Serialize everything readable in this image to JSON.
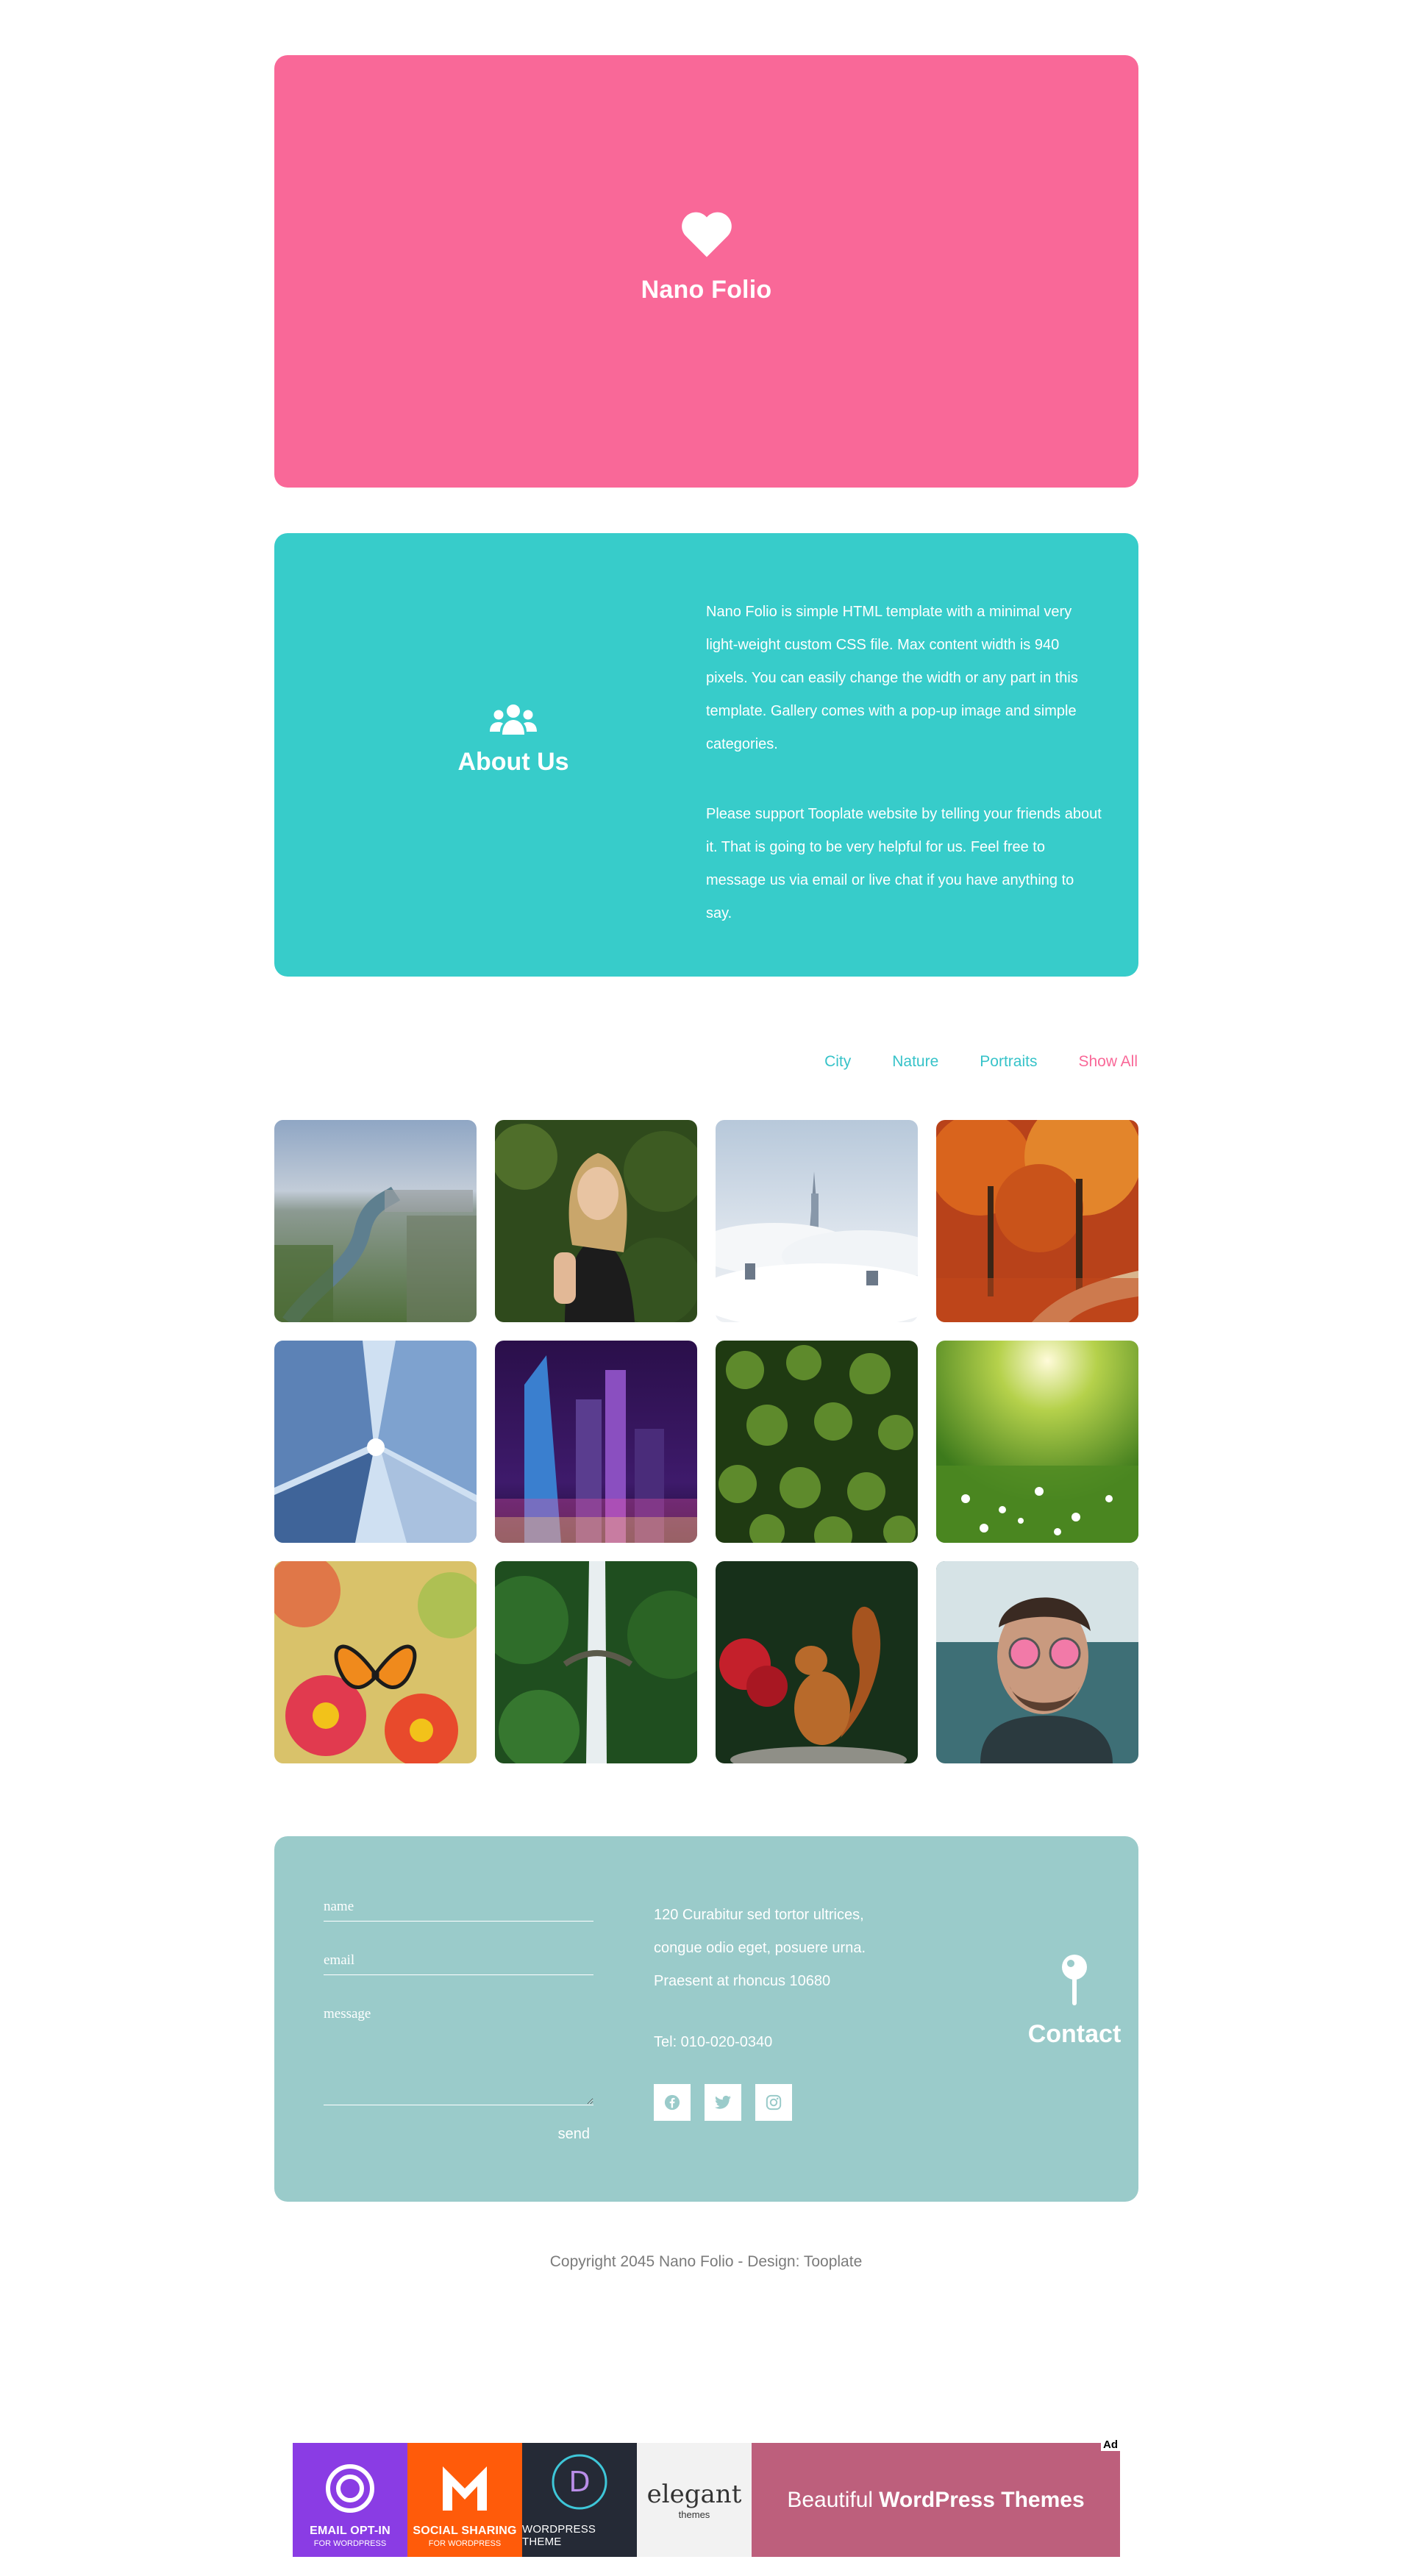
{
  "hero": {
    "title": "Nano Folio",
    "icon": "heart-icon",
    "color": "#f96898"
  },
  "about": {
    "title": "About Us",
    "icon": "users-icon",
    "color": "#37ccca",
    "paragraphs": [
      "Nano Folio is simple HTML template with a minimal very light-weight custom CSS file. Max content width is 940 pixels. You can easily change the width or any part in this template. Gallery comes with a pop-up image and simple categories.",
      "Please support Tooplate website by telling your friends about it. That is going to be very helpful for us. Feel free to message us via email or live chat if you have anything to say."
    ]
  },
  "filters": [
    "City",
    "Nature",
    "Portraits",
    "Show All"
  ],
  "filters_active": "Show All",
  "gallery": [
    {
      "name": "city-river-aerial"
    },
    {
      "name": "woman-forest-portrait"
    },
    {
      "name": "city-above-clouds"
    },
    {
      "name": "autumn-forest-path"
    },
    {
      "name": "skyscrapers-looking-up"
    },
    {
      "name": "city-night-skyline"
    },
    {
      "name": "forest-aerial-trees"
    },
    {
      "name": "sunny-meadow-flowers"
    },
    {
      "name": "butterfly-on-flowers"
    },
    {
      "name": "waterfall-bridge"
    },
    {
      "name": "red-squirrel"
    },
    {
      "name": "man-pink-sunglasses"
    }
  ],
  "contact": {
    "title": "Contact",
    "icon": "map-pin-icon",
    "color": "#9acbca",
    "form": {
      "name_placeholder": "name",
      "email_placeholder": "email",
      "message_placeholder": "message",
      "send_label": "send"
    },
    "address": [
      "120 Curabitur sed tortor ultrices,",
      "congue odio eget, posuere urna.",
      "Praesent at rhoncus 10680"
    ],
    "tel": "Tel: 010-020-0340",
    "socials": [
      "facebook-icon",
      "twitter-icon",
      "instagram-icon"
    ]
  },
  "copyright": "Copyright 2045 Nano Folio - Design: Tooplate",
  "ad": {
    "badge": "Ad",
    "blocks": [
      {
        "line1": "EMAIL OPT-IN",
        "line2": "FOR WORDPRESS"
      },
      {
        "line1": "SOCIAL SHARING",
        "line2": "FOR WORDPRESS"
      },
      {
        "line1": "WORDPRESS THEME",
        "line2": ""
      },
      {
        "line1": "elegant",
        "line2": "themes"
      }
    ],
    "headline_light": "Beautiful",
    "headline_bold": "WordPress Themes"
  }
}
